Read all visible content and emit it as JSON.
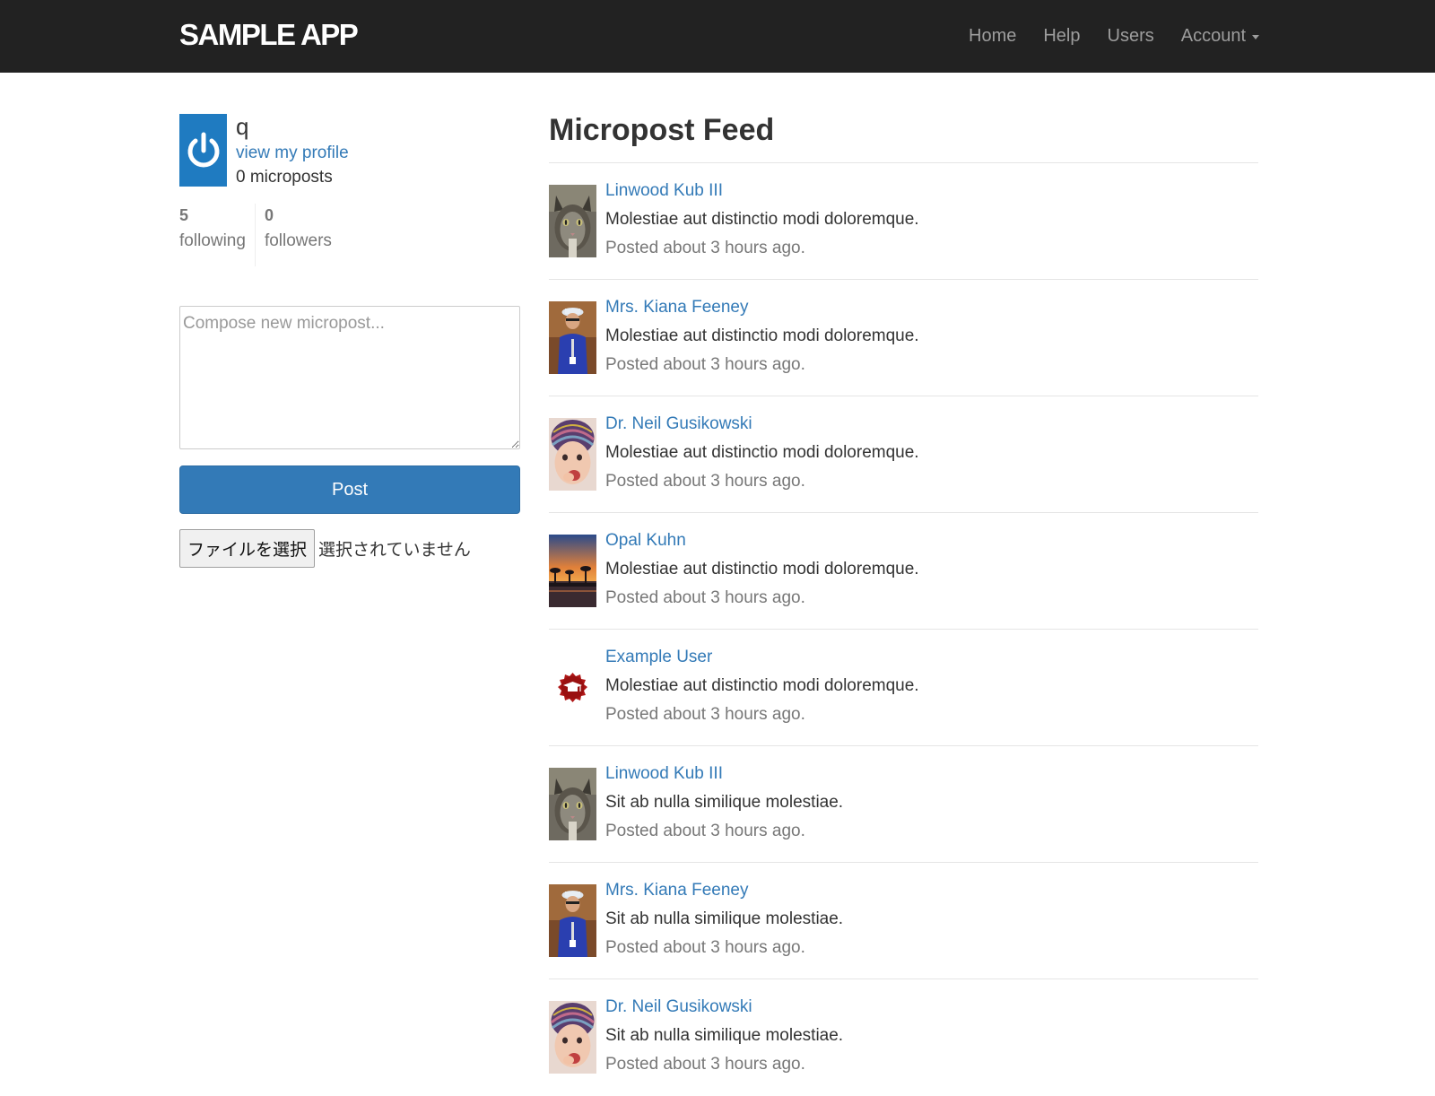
{
  "header": {
    "brand": "SAMPLE APP",
    "nav": {
      "home": "Home",
      "help": "Help",
      "users": "Users",
      "account": "Account"
    }
  },
  "sidebar": {
    "user_name": "q",
    "profile_link": "view my profile",
    "micropost_count": "0 microposts",
    "following_count": "5",
    "following_label": "following",
    "followers_count": "0",
    "followers_label": "followers",
    "compose_placeholder": "Compose new micropost...",
    "post_button": "Post",
    "file_button": "ファイルを選択",
    "file_status": "選択されていません"
  },
  "feed": {
    "title": "Micropost Feed",
    "items": [
      {
        "user": "Linwood Kub III",
        "content": "Molestiae aut distinctio modi doloremque.",
        "timestamp": "Posted about 3 hours ago.",
        "avatar": "cat-avatar"
      },
      {
        "user": "Mrs. Kiana Feeney",
        "content": "Molestiae aut distinctio modi doloremque.",
        "timestamp": "Posted about 3 hours ago.",
        "avatar": "person-avatar"
      },
      {
        "user": "Dr. Neil Gusikowski",
        "content": "Molestiae aut distinctio modi doloremque.",
        "timestamp": "Posted about 3 hours ago.",
        "avatar": "child-avatar"
      },
      {
        "user": "Opal Kuhn",
        "content": "Molestiae aut distinctio modi doloremque.",
        "timestamp": "Posted about 3 hours ago.",
        "avatar": "sunset-avatar"
      },
      {
        "user": "Example User",
        "content": "Molestiae aut distinctio modi doloremque.",
        "timestamp": "Posted about 3 hours ago.",
        "avatar": "badge-avatar"
      },
      {
        "user": "Linwood Kub III",
        "content": "Sit ab nulla similique molestiae.",
        "timestamp": "Posted about 3 hours ago.",
        "avatar": "cat-avatar"
      },
      {
        "user": "Mrs. Kiana Feeney",
        "content": "Sit ab nulla similique molestiae.",
        "timestamp": "Posted about 3 hours ago.",
        "avatar": "person-avatar"
      },
      {
        "user": "Dr. Neil Gusikowski",
        "content": "Sit ab nulla similique molestiae.",
        "timestamp": "Posted about 3 hours ago.",
        "avatar": "child-avatar"
      }
    ]
  },
  "colors": {
    "navbar_bg": "#222222",
    "link": "#337ab7",
    "post_button_bg": "#337ab7",
    "gravatar_bg": "#1f7bc1"
  }
}
